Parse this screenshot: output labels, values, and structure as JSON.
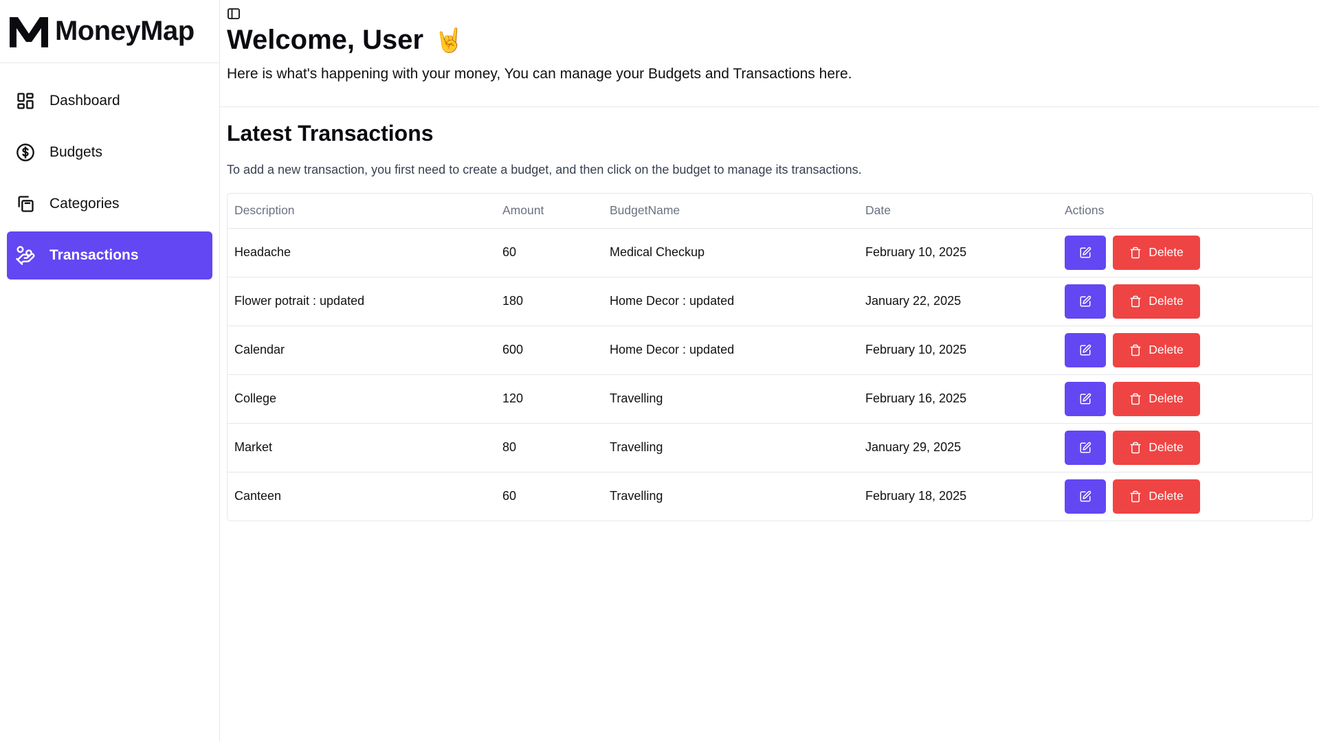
{
  "brand": {
    "name": "MoneyMap",
    "logo_icon": "moneymap-logo"
  },
  "sidebar": {
    "items": [
      {
        "label": "Dashboard",
        "icon": "dashboard-grid-icon",
        "active": false
      },
      {
        "label": "Budgets",
        "icon": "dollar-circle-icon",
        "active": false
      },
      {
        "label": "Categories",
        "icon": "copy-stack-icon",
        "active": false
      },
      {
        "label": "Transactions",
        "icon": "hand-coins-icon",
        "active": true
      }
    ]
  },
  "header": {
    "toggle_icon": "sidebar-toggle-icon",
    "welcome": "Welcome, User",
    "emoji": "🤘",
    "subtitle": "Here is what's happening with your money, You can manage your Budgets and Transactions here."
  },
  "transactions": {
    "title": "Latest Transactions",
    "description": "To add a new transaction, you first need to create a budget, and then click on the budget to manage its transactions.",
    "columns": [
      "Description",
      "Amount",
      "BudgetName",
      "Date",
      "Actions"
    ],
    "delete_label": "Delete",
    "rows": [
      {
        "description": "Headache",
        "amount": "60",
        "budget": "Medical Checkup",
        "date": "February 10, 2025"
      },
      {
        "description": "Flower potrait : updated",
        "amount": "180",
        "budget": "Home Decor : updated",
        "date": "January 22, 2025"
      },
      {
        "description": "Calendar",
        "amount": "600",
        "budget": "Home Decor : updated",
        "date": "February 10, 2025"
      },
      {
        "description": "College",
        "amount": "120",
        "budget": "Travelling",
        "date": "February 16, 2025"
      },
      {
        "description": "Market",
        "amount": "80",
        "budget": "Travelling",
        "date": "January 29, 2025"
      },
      {
        "description": "Canteen",
        "amount": "60",
        "budget": "Travelling",
        "date": "February 18, 2025"
      }
    ]
  },
  "colors": {
    "primary": "#6347f2",
    "danger": "#ef4444",
    "border": "#e5e7eb",
    "muted": "#6b7280"
  }
}
